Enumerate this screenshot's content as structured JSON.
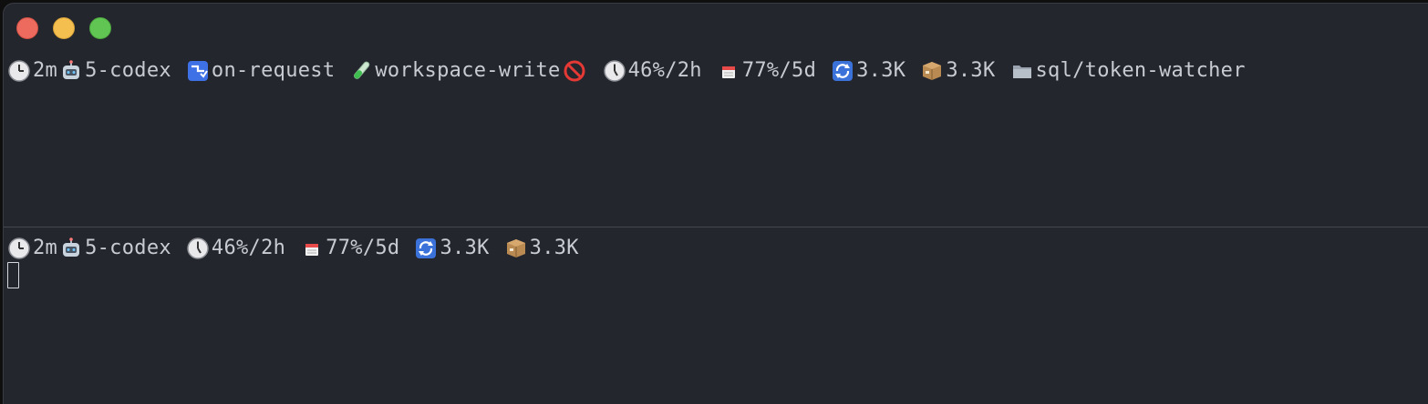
{
  "window": {
    "traffic_lights": [
      "close",
      "minimize",
      "maximize"
    ]
  },
  "top_status": {
    "time": "2m",
    "model": "5-codex",
    "approval": "on-request",
    "sandbox": "workspace-write",
    "usage_2h": "46%/2h",
    "usage_5d": "77%/5d",
    "tokens_cached": "3.3K",
    "tokens_total": "3.3K",
    "path": "sql/token-watcher"
  },
  "bottom_status": {
    "time": "2m",
    "model": "5-codex",
    "usage_2h": "46%/2h",
    "usage_5d": "77%/5d",
    "tokens_cached": "3.3K",
    "tokens_total": "3.3K"
  },
  "icons": {
    "time": "clock-icon",
    "model": "robot-icon",
    "approval": "approval-icon",
    "sandbox": "test-tube-icon",
    "no_network": "prohibited-icon",
    "usage_2h": "clock-icon",
    "usage_5d": "calendar-icon",
    "tokens_cached": "refresh-icon",
    "tokens_total": "package-icon",
    "path": "folder-icon"
  },
  "colors": {
    "background": "#24262d",
    "text": "#c9cbd2",
    "close": "#ed6a5e",
    "minimize": "#f5bf4f",
    "maximize": "#61c554"
  }
}
